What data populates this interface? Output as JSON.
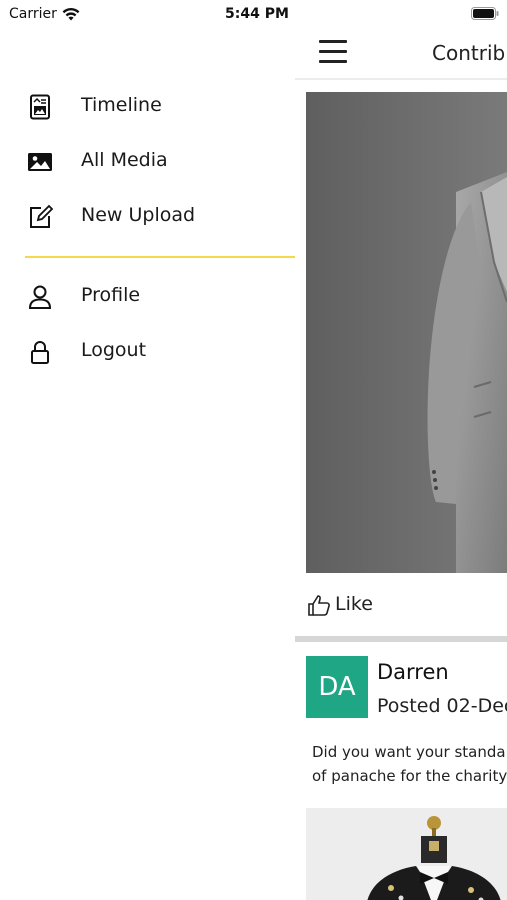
{
  "status_bar": {
    "carrier": "Carrier",
    "time": "5:44 PM"
  },
  "drawer": {
    "items": [
      {
        "label": "Timeline",
        "icon": "timeline-icon"
      },
      {
        "label": "All Media",
        "icon": "image-icon"
      },
      {
        "label": "New Upload",
        "icon": "edit-icon"
      },
      {
        "label": "Profile",
        "icon": "person-icon"
      },
      {
        "label": "Logout",
        "icon": "lock-icon"
      }
    ],
    "divider_color": "#f5d94a"
  },
  "main": {
    "title": "Contrib",
    "post": {
      "like_label": "Like",
      "avatar_initials": "DA",
      "avatar_color": "#1ea685",
      "author": "Darren",
      "posted": "Posted 02-Dec",
      "text_line1": "Did you want your standa",
      "text_line2": "of panache for the charity"
    }
  }
}
